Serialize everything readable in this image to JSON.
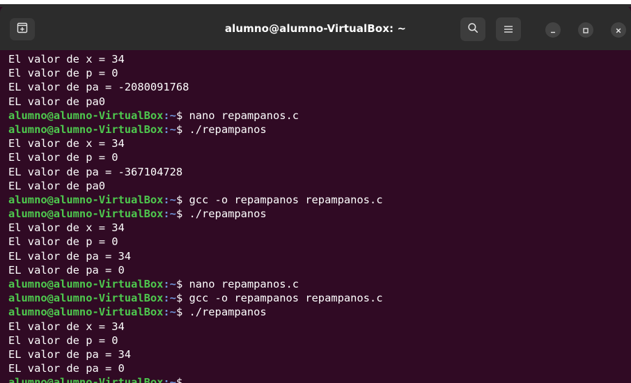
{
  "window": {
    "title": "alumno@alumno-VirtualBox: ~"
  },
  "colors": {
    "terminal_bg": "#300a24",
    "titlebar_bg": "#2c2c2c",
    "prompt_user": "#4ec94e",
    "prompt_path": "#6f93d8",
    "text": "#ffffff"
  },
  "icons": {
    "new_tab": "new-tab-icon",
    "search": "search-icon",
    "menu": "hamburger-menu-icon",
    "minimize": "minimize-icon",
    "maximize": "maximize-icon",
    "close": "close-icon"
  },
  "terminal": {
    "lines": [
      {
        "type": "output",
        "text": "El valor de x = 34"
      },
      {
        "type": "output",
        "text": "El valor de p = 0"
      },
      {
        "type": "output",
        "text": "EL valor de pa = -2080091768"
      },
      {
        "type": "output",
        "text": "EL valor de pa0"
      },
      {
        "type": "prompt",
        "user": "alumno@alumno-VirtualBox",
        "path": ":~",
        "dollar": "$ ",
        "cmd": "nano repampanos.c"
      },
      {
        "type": "prompt",
        "user": "alumno@alumno-VirtualBox",
        "path": ":~",
        "dollar": "$ ",
        "cmd": "./repampanos"
      },
      {
        "type": "output",
        "text": "El valor de x = 34"
      },
      {
        "type": "output",
        "text": "El valor de p = 0"
      },
      {
        "type": "output",
        "text": "EL valor de pa = -367104728"
      },
      {
        "type": "output",
        "text": "EL valor de pa0"
      },
      {
        "type": "prompt",
        "user": "alumno@alumno-VirtualBox",
        "path": ":~",
        "dollar": "$ ",
        "cmd": "gcc -o repampanos repampanos.c"
      },
      {
        "type": "prompt",
        "user": "alumno@alumno-VirtualBox",
        "path": ":~",
        "dollar": "$ ",
        "cmd": "./repampanos"
      },
      {
        "type": "output",
        "text": "El valor de x = 34"
      },
      {
        "type": "output",
        "text": "El valor de p = 0"
      },
      {
        "type": "output",
        "text": "EL valor de pa = 34"
      },
      {
        "type": "output",
        "text": "EL valor de pa = 0"
      },
      {
        "type": "prompt",
        "user": "alumno@alumno-VirtualBox",
        "path": ":~",
        "dollar": "$ ",
        "cmd": "nano repampanos.c"
      },
      {
        "type": "prompt",
        "user": "alumno@alumno-VirtualBox",
        "path": ":~",
        "dollar": "$ ",
        "cmd": "gcc -o repampanos repampanos.c"
      },
      {
        "type": "prompt",
        "user": "alumno@alumno-VirtualBox",
        "path": ":~",
        "dollar": "$ ",
        "cmd": "./repampanos"
      },
      {
        "type": "output",
        "text": "El valor de x = 34"
      },
      {
        "type": "output",
        "text": "El valor de p = 0"
      },
      {
        "type": "output",
        "text": "EL valor de pa = 34"
      },
      {
        "type": "output",
        "text": "EL valor de pa = 0"
      },
      {
        "type": "prompt",
        "user": "alumno@alumno-VirtualBox",
        "path": ":~",
        "dollar": "$ ",
        "cmd": ""
      }
    ]
  }
}
